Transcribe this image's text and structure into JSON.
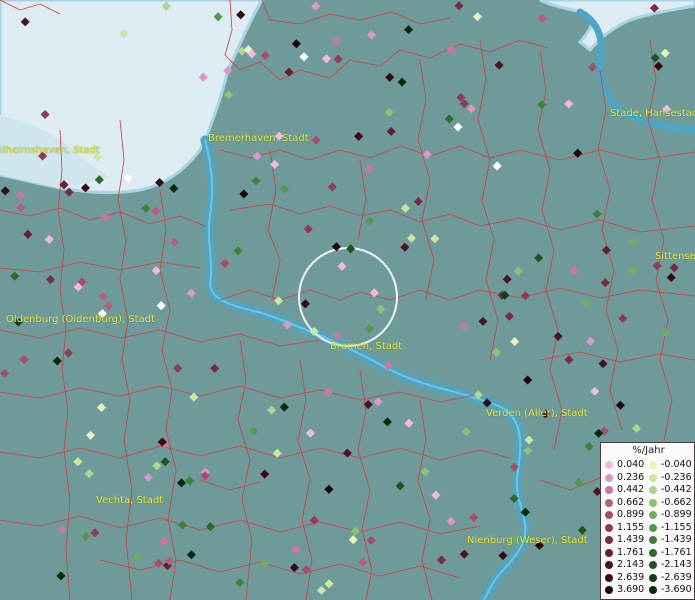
{
  "map": {
    "labels": [
      {
        "text": "ilhelmshaven, Stadt",
        "name": "label-wilhelmshaven"
      },
      {
        "text": "Bremerhaven, Stadt",
        "name": "label-bremerhaven"
      },
      {
        "text": "Stade, Hansestad",
        "name": "label-stade"
      },
      {
        "text": "Sittense",
        "name": "label-sittensen"
      },
      {
        "text": "Oldenburg (Oldenburg), Stadt",
        "name": "label-oldenburg"
      },
      {
        "text": "Bremen, Stadt",
        "name": "label-bremen"
      },
      {
        "text": "Verden (Aller), Stadt",
        "name": "label-verden"
      },
      {
        "text": "Vechta, Stadt",
        "name": "label-vechta"
      },
      {
        "text": "Nienburg (Weser), Stadt",
        "name": "label-nienburg"
      }
    ],
    "colors": {
      "background": "#6f9a9a",
      "border": "#d23c3c",
      "river": "#4aa6c4",
      "sea": "#dcecf2",
      "label": "#ecec34"
    }
  },
  "legend": {
    "title": "%/Jahr",
    "positive": [
      {
        "value": "0.040",
        "color": "#f2b8e2"
      },
      {
        "value": "0.236",
        "color": "#e194c6"
      },
      {
        "value": "0.442",
        "color": "#d0749e"
      },
      {
        "value": "0.662",
        "color": "#bd5a7e"
      },
      {
        "value": "0.899",
        "color": "#a84a68"
      },
      {
        "value": "1.155",
        "color": "#923a54"
      },
      {
        "value": "1.439",
        "color": "#7c2c42"
      },
      {
        "value": "1.761",
        "color": "#642030"
      },
      {
        "value": "2.143",
        "color": "#4c1422"
      },
      {
        "value": "2.639",
        "color": "#360a14"
      },
      {
        "value": "3.690",
        "color": "#20040a"
      }
    ],
    "negative": [
      {
        "value": "-0.040",
        "color": "#eaf4b8"
      },
      {
        "value": "-0.236",
        "color": "#cce6a0"
      },
      {
        "value": "-0.442",
        "color": "#acd68a"
      },
      {
        "value": "-0.662",
        "color": "#8cc274"
      },
      {
        "value": "-0.899",
        "color": "#70ae5e"
      },
      {
        "value": "-1.155",
        "color": "#56984a"
      },
      {
        "value": "-1.439",
        "color": "#3e8238"
      },
      {
        "value": "-1.761",
        "color": "#2c6c2a"
      },
      {
        "value": "-2.143",
        "color": "#1c561e"
      },
      {
        "value": "-2.639",
        "color": "#104012"
      },
      {
        "value": "-3.690",
        "color": "#062a08"
      }
    ]
  }
}
